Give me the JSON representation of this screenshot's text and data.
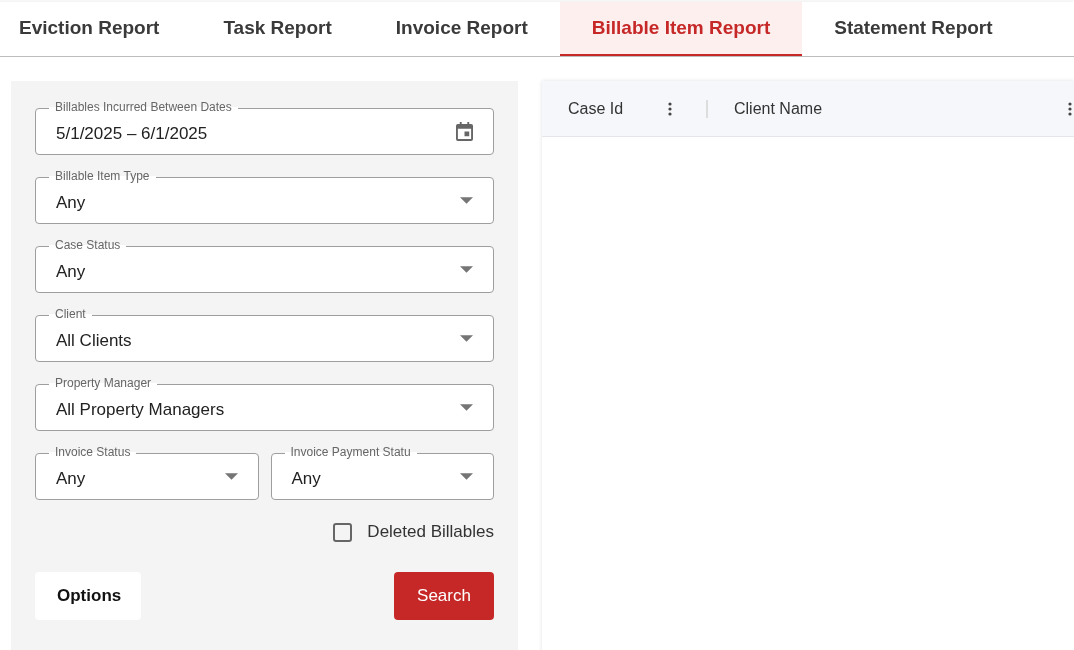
{
  "tabs": [
    {
      "label": "Eviction Report",
      "selected": false
    },
    {
      "label": "Task Report",
      "selected": false
    },
    {
      "label": "Invoice Report",
      "selected": false
    },
    {
      "label": "Billable Item Report",
      "selected": true
    },
    {
      "label": "Statement Report",
      "selected": false
    }
  ],
  "filter_rows": [
    [
      {
        "kind": "date",
        "label": "Billables Incurred Between Dates",
        "value": "5/1/2025 – 6/1/2025"
      }
    ],
    [
      {
        "kind": "select",
        "label": "Billable Item Type",
        "value": "Any"
      }
    ],
    [
      {
        "kind": "select",
        "label": "Case Status",
        "value": "Any"
      }
    ],
    [
      {
        "kind": "select",
        "label": "Client",
        "value": "All Clients"
      }
    ],
    [
      {
        "kind": "select",
        "label": "Property Manager",
        "value": "All Property Managers"
      }
    ],
    [
      {
        "kind": "select",
        "label": "Invoice Status",
        "value": "Any"
      },
      {
        "kind": "select",
        "label": "Invoice Payment Statu",
        "value": "Any"
      }
    ]
  ],
  "deleted_billables": {
    "label": "Deleted Billables",
    "checked": false
  },
  "buttons": {
    "options": "Options",
    "search": "Search"
  },
  "table": {
    "columns": [
      "Case Id",
      "Client Name"
    ]
  }
}
